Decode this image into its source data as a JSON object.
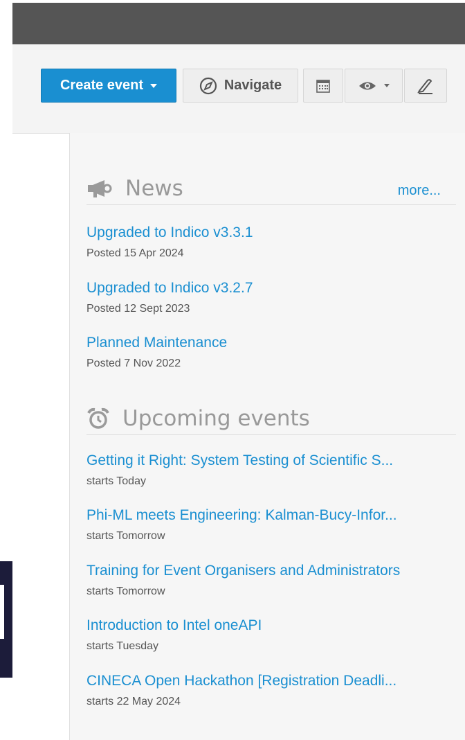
{
  "toolbar": {
    "create_event_label": "Create event",
    "navigate_label": "Navigate",
    "icons": [
      "compass-icon",
      "calendar-icon",
      "eye-icon",
      "pen-icon"
    ]
  },
  "news": {
    "title": "News",
    "more_label": "more...",
    "items": [
      {
        "title": "Upgraded to Indico v3.3.1",
        "posted": "Posted 15 Apr 2024"
      },
      {
        "title": "Upgraded to Indico v3.2.7",
        "posted": "Posted 12 Sept 2023"
      },
      {
        "title": "Planned Maintenance",
        "posted": "Posted 7 Nov 2022"
      }
    ]
  },
  "upcoming": {
    "title": "Upcoming events",
    "items": [
      {
        "title": "Getting it Right: System Testing of Scientific S...",
        "starts": "starts Today"
      },
      {
        "title": "Phi-ML meets Engineering: Kalman-Bucy-Infor...",
        "starts": "starts Tomorrow"
      },
      {
        "title": "Training for Event Organisers and Administrators",
        "starts": "starts Tomorrow"
      },
      {
        "title": "Introduction to Intel oneAPI",
        "starts": "starts Tuesday"
      },
      {
        "title": "CINECA Open Hackathon [Registration Deadli...",
        "starts": "starts 22 May 2024"
      }
    ]
  },
  "colors": {
    "accent": "#1a8fd1",
    "topbar": "#555555",
    "panel": "#f6f6f6"
  }
}
